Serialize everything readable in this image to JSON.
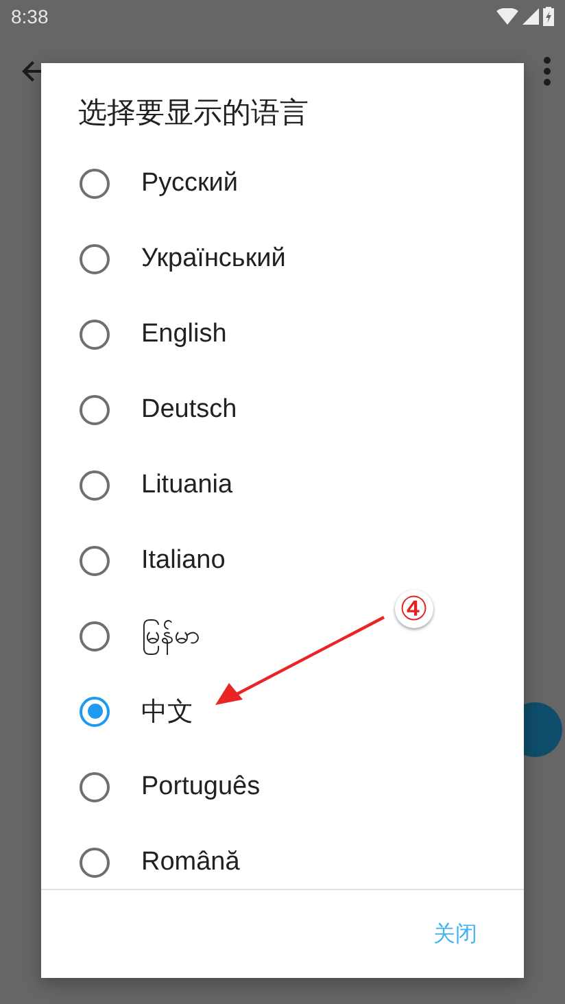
{
  "status_bar": {
    "time": "8:38"
  },
  "dialog": {
    "title": "选择要显示的语言",
    "options": [
      {
        "label": "Русский",
        "selected": false
      },
      {
        "label": "Український",
        "selected": false
      },
      {
        "label": "English",
        "selected": false
      },
      {
        "label": "Deutsch",
        "selected": false
      },
      {
        "label": "Lituania",
        "selected": false
      },
      {
        "label": "Italiano",
        "selected": false
      },
      {
        "label": "မြန်မာ",
        "selected": false
      },
      {
        "label": "中文",
        "selected": true
      },
      {
        "label": "Português",
        "selected": false
      },
      {
        "label": "Română",
        "selected": false
      }
    ],
    "close_button": "关闭"
  },
  "annotation": {
    "label": "④"
  }
}
